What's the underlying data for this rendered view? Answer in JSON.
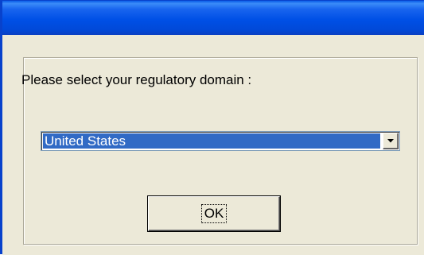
{
  "dialog": {
    "prompt": "Please select your regulatory domain  :",
    "domain_select": {
      "selected_value": "United States"
    },
    "ok_label": "OK"
  },
  "icons": {
    "dropdown": "chevron-down-icon"
  },
  "colors": {
    "titlebar": "#0050e6",
    "dialog_bg": "#ece9d8",
    "selection": "#316ac5"
  }
}
